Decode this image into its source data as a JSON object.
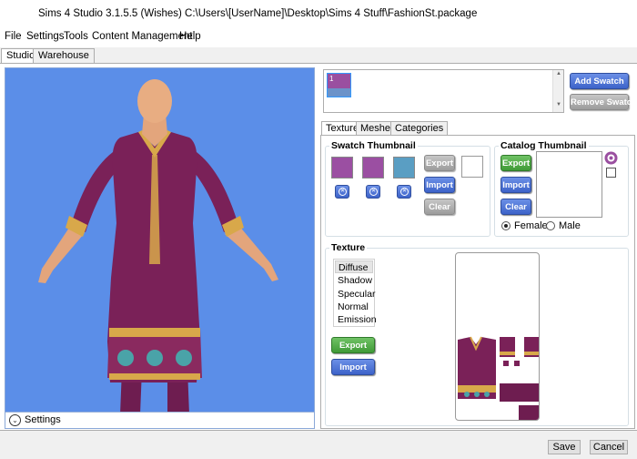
{
  "window": {
    "title": "Sims 4 Studio 3.1.5.5 (Wishes)  C:\\Users\\[UserName]\\Desktop\\Sims 4 Stuff\\FashionSt.package"
  },
  "menu": {
    "items": [
      "File",
      "Settings",
      "Tools",
      "Content Management",
      "Help"
    ]
  },
  "top_tabs": [
    {
      "label": "Studio",
      "active": true
    },
    {
      "label": "Warehouse",
      "active": false
    }
  ],
  "viewport": {
    "settings_label": "Settings",
    "background_color": "#5b8ee8"
  },
  "swatch_list": {
    "items": [
      {
        "number": "1",
        "color": "#9a4fa0"
      }
    ],
    "add_label": "Add Swatch",
    "remove_label": "Remove Swatch"
  },
  "sub_tabs": [
    {
      "label": "Texture",
      "active": true
    },
    {
      "label": "Meshes",
      "active": false
    },
    {
      "label": "Categories",
      "active": false
    }
  ],
  "swatch_thumbnail": {
    "label": "Swatch Thumbnail",
    "colors": [
      "#9b4fa2",
      "#9b4fa2",
      "#5a9ec3"
    ],
    "export_label": "Export",
    "import_label": "Import",
    "clear_label": "Clear"
  },
  "catalog_thumbnail": {
    "label": "Catalog Thumbnail",
    "export_label": "Export",
    "import_label": "Import",
    "clear_label": "Clear",
    "female_label": "Female",
    "male_label": "Male",
    "selected_gender": "Female"
  },
  "texture": {
    "label": "Texture",
    "items": [
      "Diffuse",
      "Shadow",
      "Specular",
      "Normal",
      "Emission"
    ],
    "selected": "Diffuse",
    "export_label": "Export",
    "import_label": "Import"
  },
  "footer": {
    "save_label": "Save",
    "cancel_label": "Cancel"
  },
  "colors": {
    "garment": "#7a2158",
    "embroidery": "#d8a84a",
    "skin": "#e3a57c",
    "accent_blue": "#3d63c9",
    "accent_green": "#3f9a37"
  }
}
